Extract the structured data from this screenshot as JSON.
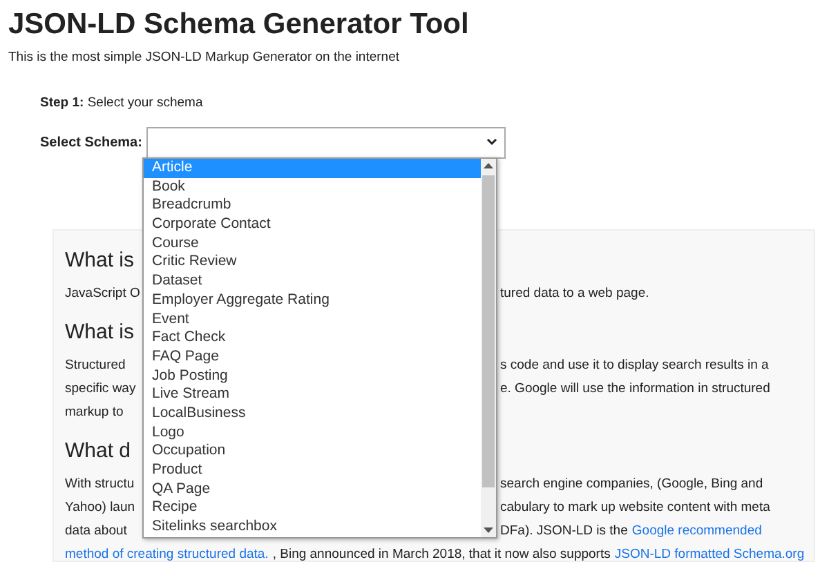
{
  "title": "JSON-LD Schema Generator Tool",
  "subtitle": "This is the most simple JSON-LD Markup Generator on the internet",
  "step": {
    "label": "Step 1:",
    "text": "Select your schema"
  },
  "select": {
    "label": "Select Schema:"
  },
  "dropdown": {
    "options": [
      {
        "label": "Article",
        "selected": true
      },
      {
        "label": "Book",
        "selected": false
      },
      {
        "label": "Breadcrumb",
        "selected": false
      },
      {
        "label": "Corporate Contact",
        "selected": false
      },
      {
        "label": "Course",
        "selected": false
      },
      {
        "label": "Critic Review",
        "selected": false
      },
      {
        "label": "Dataset",
        "selected": false
      },
      {
        "label": "Employer Aggregate Rating",
        "selected": false
      },
      {
        "label": "Event",
        "selected": false
      },
      {
        "label": "Fact Check",
        "selected": false
      },
      {
        "label": "FAQ Page",
        "selected": false
      },
      {
        "label": "Job Posting",
        "selected": false
      },
      {
        "label": "Live Stream",
        "selected": false
      },
      {
        "label": "LocalBusiness",
        "selected": false
      },
      {
        "label": "Logo",
        "selected": false
      },
      {
        "label": "Occupation",
        "selected": false
      },
      {
        "label": "Product",
        "selected": false
      },
      {
        "label": "QA Page",
        "selected": false
      },
      {
        "label": "Recipe",
        "selected": false
      },
      {
        "label": "Sitelinks searchbox",
        "selected": false
      }
    ]
  },
  "info_card": {
    "sections": [
      {
        "heading": "What is",
        "lines": [
          {
            "left": [
              {
                "kind": "text",
                "text": "JavaScript O"
              }
            ],
            "right": [
              {
                "kind": "text",
                "text": "tured data to a web page."
              }
            ]
          }
        ]
      },
      {
        "heading": "What is",
        "lines": [
          {
            "left": [
              {
                "kind": "text",
                "text": "Structured"
              }
            ],
            "right": [
              {
                "kind": "text",
                "text": "s code and use it to display search results in a"
              }
            ]
          },
          {
            "left": [
              {
                "kind": "text",
                "text": "specific way"
              }
            ],
            "right": [
              {
                "kind": "text",
                "text": "e. Google will use the information in structured"
              }
            ]
          },
          {
            "left": [
              {
                "kind": "text",
                "text": "markup to"
              }
            ]
          }
        ]
      },
      {
        "heading": "What d",
        "lines": [
          {
            "left": [
              {
                "kind": "text",
                "text": "With structu"
              }
            ],
            "right": [
              {
                "kind": "text",
                "text": "search engine companies, (Google, Bing and"
              }
            ]
          },
          {
            "left": [
              {
                "kind": "text",
                "text": "Yahoo) laun"
              }
            ],
            "right": [
              {
                "kind": "text",
                "text": "cabulary to mark up website content with meta"
              }
            ]
          },
          {
            "left": [
              {
                "kind": "text",
                "text": "data about"
              }
            ],
            "right": [
              {
                "kind": "text",
                "text": "DFa). JSON-LD is the"
              },
              {
                "kind": "link",
                "text": "Google recommended"
              }
            ]
          },
          {
            "full": [
              {
                "kind": "link",
                "text": "method of creating structured data."
              },
              {
                "kind": "text",
                "text": ", Bing announced in March 2018, that it now also supports"
              },
              {
                "kind": "link",
                "text": "JSON-LD formatted Schema.org"
              }
            ]
          }
        ]
      }
    ]
  }
}
